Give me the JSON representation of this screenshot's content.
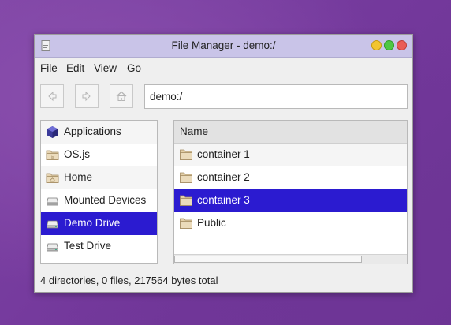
{
  "window": {
    "title": "File Manager - demo:/"
  },
  "menu": {
    "file": "File",
    "edit": "Edit",
    "view": "View",
    "go": "Go"
  },
  "toolbar": {
    "back_icon": "arrow-left-icon",
    "forward_icon": "arrow-right-icon",
    "home_icon": "home-icon"
  },
  "path": {
    "value": "demo:/"
  },
  "sidebar": {
    "items": [
      {
        "label": "Applications",
        "icon": "cube-icon"
      },
      {
        "label": "OS.js",
        "icon": "folder-icon"
      },
      {
        "label": "Home",
        "icon": "folder-home-icon"
      },
      {
        "label": "Mounted Devices",
        "icon": "drive-icon"
      },
      {
        "label": "Demo Drive",
        "icon": "drive-icon",
        "selected": true
      },
      {
        "label": "Test Drive",
        "icon": "drive-icon"
      }
    ]
  },
  "filelist": {
    "column_name": "Name",
    "rows": [
      {
        "label": "container 1",
        "icon": "folder-icon"
      },
      {
        "label": "container 2",
        "icon": "folder-icon"
      },
      {
        "label": "container 3",
        "icon": "folder-icon",
        "selected": true
      },
      {
        "label": "Public",
        "icon": "folder-icon"
      }
    ]
  },
  "status": {
    "text": "4 directories, 0 files, 217564 bytes total"
  },
  "colors": {
    "selection": "#2b1bd0",
    "titlebar": "#c9c4e8",
    "desktop": "#7e44a5"
  }
}
